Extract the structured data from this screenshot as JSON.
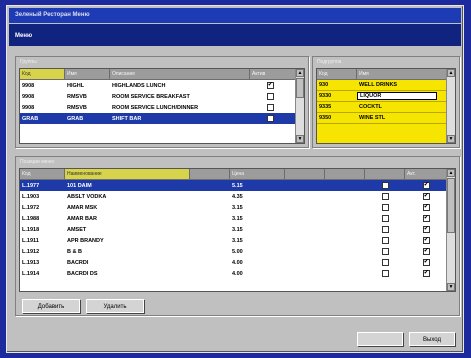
{
  "window": {
    "title": "Зеленый Ресторан Меню",
    "menu_label": "Меню"
  },
  "top_left": {
    "section_label": "Группы",
    "headers": [
      "Код",
      "Имя",
      "Описание",
      "Актив"
    ],
    "rows": [
      {
        "code": "9908",
        "name": "HIGHL",
        "desc": "HIGHLANDS LUNCH",
        "active": true,
        "selected": false
      },
      {
        "code": "9908",
        "name": "RMSVB",
        "desc": "ROOM SERVICE BREAKFAST",
        "active": false,
        "selected": false
      },
      {
        "code": "9908",
        "name": "RMSVB",
        "desc": "ROOM SERVICE LUNCH/DINNER",
        "active": false,
        "selected": false
      },
      {
        "code": "GRAB",
        "name": "GRAB",
        "desc": "SHIFT BAR",
        "active": false,
        "selected": true
      }
    ]
  },
  "top_right": {
    "section_label": "Подгруппа",
    "headers": [
      "Код",
      "Имя"
    ],
    "rows": [
      {
        "code": "930",
        "name": "WELL DRINKS",
        "current": false
      },
      {
        "code": "9330",
        "name": "LIQUOR",
        "current": true
      },
      {
        "code": "9335",
        "name": "COCKTL",
        "current": false
      },
      {
        "code": "9350",
        "name": "WINE STL",
        "current": false
      }
    ]
  },
  "items": {
    "section_label": "Позиции меню",
    "headers": [
      "Код",
      "Наименование",
      "",
      "Цена",
      "",
      "",
      "",
      "Акт."
    ],
    "rows": [
      {
        "code": "L.1977",
        "name": "101 DAIM",
        "price": "5.15",
        "flag1": false,
        "flag2": true,
        "selected": true
      },
      {
        "code": "L.1903",
        "name": "ABSLT VODKA",
        "price": "4.35",
        "flag1": false,
        "flag2": true,
        "selected": false
      },
      {
        "code": "L.1972",
        "name": "AMAR MSK",
        "price": "3.15",
        "flag1": false,
        "flag2": true,
        "selected": false
      },
      {
        "code": "L.1988",
        "name": "AMAR BAR",
        "price": "3.15",
        "flag1": false,
        "flag2": true,
        "selected": false
      },
      {
        "code": "L.1918",
        "name": "AMSET",
        "price": "3.15",
        "flag1": false,
        "flag2": true,
        "selected": false
      },
      {
        "code": "L.1911",
        "name": "APR BRANDY",
        "price": "3.15",
        "flag1": false,
        "flag2": true,
        "selected": false
      },
      {
        "code": "L.1912",
        "name": "B & B",
        "price": "5.00",
        "flag1": false,
        "flag2": true,
        "selected": false
      },
      {
        "code": "L.1913",
        "name": "BACRDI",
        "price": "4.00",
        "flag1": false,
        "flag2": true,
        "selected": false
      },
      {
        "code": "L.1914",
        "name": "BACRDI DS",
        "price": "4.00",
        "flag1": false,
        "flag2": true,
        "selected": false
      }
    ]
  },
  "buttons": {
    "add": "Добавить",
    "delete": "Удалить",
    "ok": "",
    "close": "Выход"
  }
}
